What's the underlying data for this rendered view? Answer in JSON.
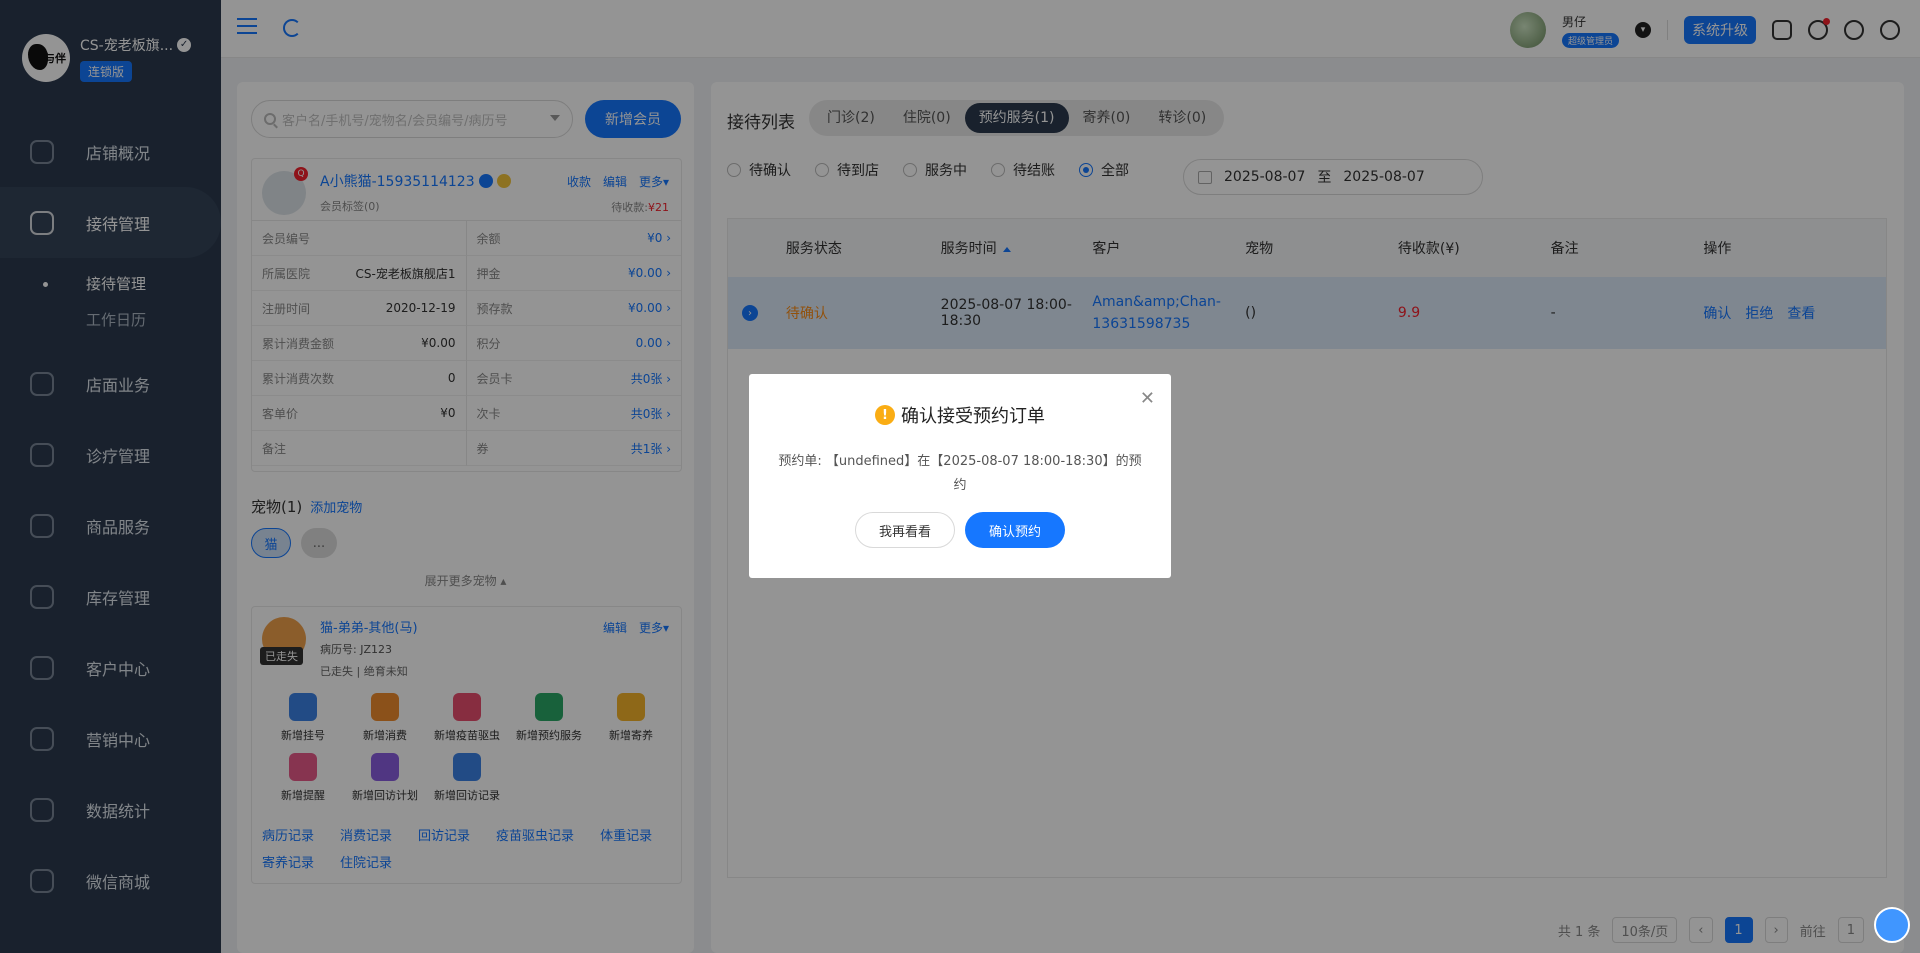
{
  "brand": {
    "name": "CS-宠老板旗...",
    "logo_text": "与伴",
    "edition": "连锁版"
  },
  "nav": {
    "items": [
      {
        "label": "店铺概况",
        "icon": "store-overview-icon"
      },
      {
        "label": "接待管理",
        "icon": "reception-icon"
      },
      {
        "label": "店面业务",
        "icon": "store-business-icon"
      },
      {
        "label": "诊疗管理",
        "icon": "medical-icon"
      },
      {
        "label": "商品服务",
        "icon": "goods-icon"
      },
      {
        "label": "库存管理",
        "icon": "inventory-icon"
      },
      {
        "label": "客户中心",
        "icon": "customer-icon"
      },
      {
        "label": "营销中心",
        "icon": "marketing-icon"
      },
      {
        "label": "数据统计",
        "icon": "stats-icon"
      },
      {
        "label": "微信商城",
        "icon": "wechat-mall-icon"
      }
    ],
    "sub_items": [
      "接待管理",
      "工作日历"
    ]
  },
  "header": {
    "user_name": "男仔",
    "user_role": "超级管理员",
    "upgrade_label": "系统升级"
  },
  "left": {
    "search_placeholder": "客户名/手机号/宠物名/会员编号/病历号",
    "add_member_label": "新增会员",
    "member": {
      "name": "A小熊猫-15935114123",
      "tags": "会员标签(0)",
      "actions": [
        "收款",
        "编辑",
        "更多▾"
      ],
      "due_label": "待收款:",
      "due_value": "¥21",
      "rows": [
        {
          "k": "会员编号",
          "v": ""
        },
        {
          "k": "余额",
          "v": "¥0 ›"
        },
        {
          "k": "所属医院",
          "v": "CS-宠老板旗舰店1"
        },
        {
          "k": "押金",
          "v": "¥0.00 ›"
        },
        {
          "k": "注册时间",
          "v": "2020-12-19"
        },
        {
          "k": "预存款",
          "v": "¥0.00 ›"
        },
        {
          "k": "累计消费金额",
          "v": "¥0.00"
        },
        {
          "k": "积分",
          "v": "0.00 ›"
        },
        {
          "k": "累计消费次数",
          "v": "0"
        },
        {
          "k": "会员卡",
          "v": "共0张 ›"
        },
        {
          "k": "客单价",
          "v": "¥0"
        },
        {
          "k": "次卡",
          "v": "共0张 ›"
        },
        {
          "k": "备注",
          "v": ""
        },
        {
          "k": "券",
          "v": "共1张 ›"
        }
      ]
    },
    "pets_title": "宠物(1)",
    "add_pet_label": "添加宠物",
    "pet_chip_cat": "猫",
    "pet_chip_more": "...",
    "expand_more": "展开更多宠物 ▴",
    "pet": {
      "name": "猫-弟弟-其他(马)",
      "record": "病历号: JZ123",
      "status": "已走失 | 绝育未知",
      "lost_badge": "已走失",
      "actions": [
        "编辑",
        "更多▾"
      ],
      "quick_actions": [
        {
          "label": "新增挂号",
          "color": "#3c82e6"
        },
        {
          "label": "新增消费",
          "color": "#f08c2e"
        },
        {
          "label": "新增疫苗驱虫",
          "color": "#e84f6f"
        },
        {
          "label": "新增预约服务",
          "color": "#2aa866"
        },
        {
          "label": "新增寄养",
          "color": "#f4b42a"
        },
        {
          "label": "新增提醒",
          "color": "#e85a8a"
        },
        {
          "label": "新增回访计划",
          "color": "#8a5ee0"
        },
        {
          "label": "新增回访记录",
          "color": "#3c82e6"
        }
      ],
      "links": [
        "病历记录",
        "消费记录",
        "回访记录",
        "疫苗驱虫记录",
        "体重记录",
        "寄养记录",
        "住院记录"
      ]
    }
  },
  "right": {
    "title": "接待列表",
    "tabs": [
      "门诊(2)",
      "住院(0)",
      "预约服务(1)",
      "寄养(0)",
      "转诊(0)"
    ],
    "filters": [
      "待确认",
      "待到店",
      "服务中",
      "待结账",
      "全部"
    ],
    "date_from": "2025-08-07",
    "date_to_label": "至",
    "date_to": "2025-08-07",
    "columns": [
      "服务状态",
      "服务时间",
      "客户",
      "宠物",
      "待收款(¥)",
      "备注",
      "操作"
    ],
    "row": {
      "status": "待确认",
      "time": "2025-08-07 18:00-18:30",
      "customer": "Aman&amp;Chan-13631598735",
      "pet": "()",
      "due": "9.9",
      "note": "-",
      "ops": [
        "确认",
        "拒绝",
        "查看"
      ]
    },
    "pager": {
      "total": "共 1 条",
      "page_size": "10条/页",
      "current": "1",
      "goto_label": "前往",
      "goto_value": "1"
    }
  },
  "modal": {
    "title": "确认接受预约订单",
    "body": "预约单: 【undefined】在【2025-08-07 18:00-18:30】的预约",
    "cancel_label": "我再看看",
    "confirm_label": "确认预约"
  }
}
